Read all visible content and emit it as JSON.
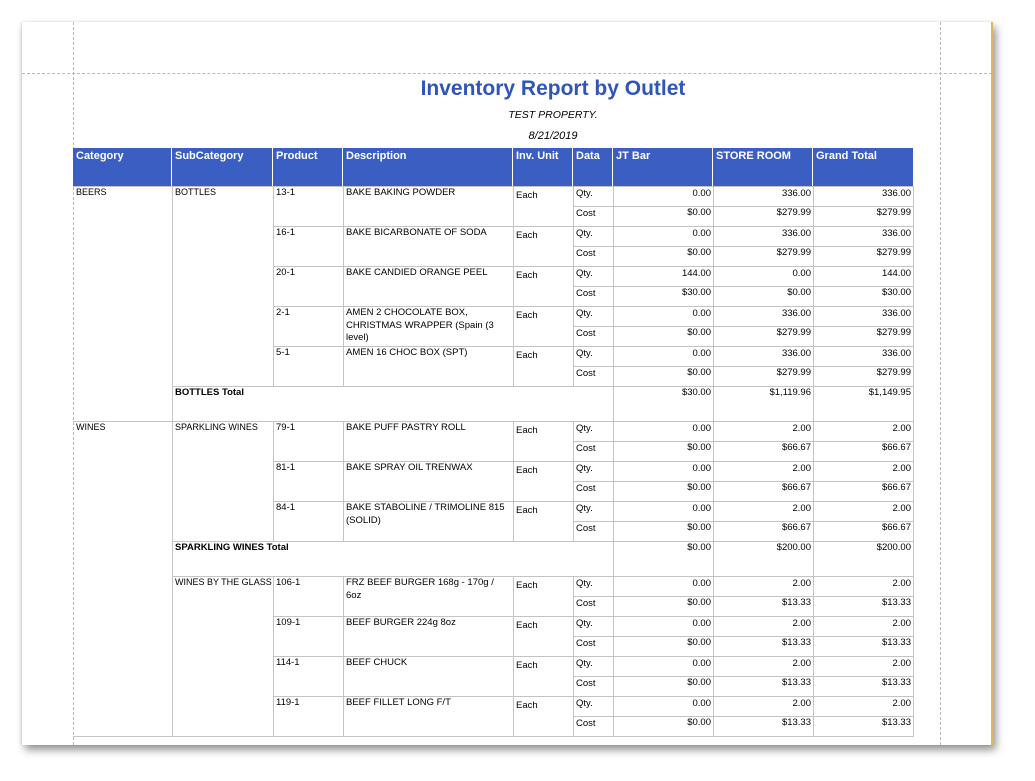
{
  "report": {
    "title": "Inventory Report by Outlet",
    "property": "TEST PROPERTY.",
    "date": "8/21/2019"
  },
  "colors": {
    "title": "#2f55b8",
    "header_bg": "#3b5ec3",
    "header_text": "#ffffff",
    "grid": "#c4c4c4"
  },
  "columns": [
    "Category",
    "SubCategory",
    "Product",
    "Description",
    "Inv. Unit",
    "Data",
    "JT Bar",
    "STORE ROOM",
    "Grand Total"
  ],
  "row_labels": {
    "qty": "Qty.",
    "cost": "Cost"
  },
  "groups": [
    {
      "category": "BEERS",
      "subgroups": [
        {
          "subcategory": "BOTTLES",
          "products": [
            {
              "product": "13-1",
              "description": "BAKE BAKING POWDER",
              "unit": "Each",
              "qty": [
                "0.00",
                "336.00",
                "336.00"
              ],
              "cost": [
                "$0.00",
                "$279.99",
                "$279.99"
              ]
            },
            {
              "product": "16-1",
              "description": "BAKE BICARBONATE OF SODA",
              "unit": "Each",
              "qty": [
                "0.00",
                "336.00",
                "336.00"
              ],
              "cost": [
                "$0.00",
                "$279.99",
                "$279.99"
              ]
            },
            {
              "product": "20-1",
              "description": "BAKE CANDIED ORANGE PEEL",
              "unit": "Each",
              "qty": [
                "144.00",
                "0.00",
                "144.00"
              ],
              "cost": [
                "$30.00",
                "$0.00",
                "$30.00"
              ]
            },
            {
              "product": "2-1",
              "description": "AMEN 2 CHOCOLATE BOX, CHRISTMAS WRAPPER (Spain (3 level)",
              "unit": "Each",
              "qty": [
                "0.00",
                "336.00",
                "336.00"
              ],
              "cost": [
                "$0.00",
                "$279.99",
                "$279.99"
              ]
            },
            {
              "product": "5-1",
              "description": "AMEN 16 CHOC BOX (SPT)",
              "unit": "Each",
              "qty": [
                "0.00",
                "336.00",
                "336.00"
              ],
              "cost": [
                "$0.00",
                "$279.99",
                "$279.99"
              ]
            }
          ],
          "total": {
            "label": "BOTTLES Total",
            "values": [
              "$30.00",
              "$1,119.96",
              "$1,149.95"
            ]
          }
        }
      ]
    },
    {
      "category": "WINES",
      "subgroups": [
        {
          "subcategory": "SPARKLING WINES",
          "products": [
            {
              "product": "79-1",
              "description": "BAKE PUFF PASTRY ROLL",
              "unit": "Each",
              "qty": [
                "0.00",
                "2.00",
                "2.00"
              ],
              "cost": [
                "$0.00",
                "$66.67",
                "$66.67"
              ]
            },
            {
              "product": "81-1",
              "description": "BAKE SPRAY OIL TRENWAX",
              "unit": "Each",
              "qty": [
                "0.00",
                "2.00",
                "2.00"
              ],
              "cost": [
                "$0.00",
                "$66.67",
                "$66.67"
              ]
            },
            {
              "product": "84-1",
              "description": "BAKE STABOLINE / TRIMOLINE 815 (SOLID)",
              "unit": "Each",
              "qty": [
                "0.00",
                "2.00",
                "2.00"
              ],
              "cost": [
                "$0.00",
                "$66.67",
                "$66.67"
              ]
            }
          ],
          "total": {
            "label": "SPARKLING WINES Total",
            "values": [
              "$0.00",
              "$200.00",
              "$200.00"
            ]
          }
        },
        {
          "subcategory": "WINES BY THE GLASS",
          "products": [
            {
              "product": "106-1",
              "description": "FRZ BEEF BURGER 168g - 170g / 6oz",
              "unit": "Each",
              "qty": [
                "0.00",
                "2.00",
                "2.00"
              ],
              "cost": [
                "$0.00",
                "$13.33",
                "$13.33"
              ]
            },
            {
              "product": "109-1",
              "description": "BEEF BURGER 224g 8oz",
              "unit": "Each",
              "qty": [
                "0.00",
                "2.00",
                "2.00"
              ],
              "cost": [
                "$0.00",
                "$13.33",
                "$13.33"
              ]
            },
            {
              "product": "114-1",
              "description": "BEEF CHUCK",
              "unit": "Each",
              "qty": [
                "0.00",
                "2.00",
                "2.00"
              ],
              "cost": [
                "$0.00",
                "$13.33",
                "$13.33"
              ]
            },
            {
              "product": "119-1",
              "description": "BEEF FILLET LONG F/T",
              "unit": "Each",
              "qty": [
                "0.00",
                "2.00",
                "2.00"
              ],
              "cost": [
                "$0.00",
                "$13.33",
                "$13.33"
              ]
            }
          ]
        }
      ]
    }
  ]
}
